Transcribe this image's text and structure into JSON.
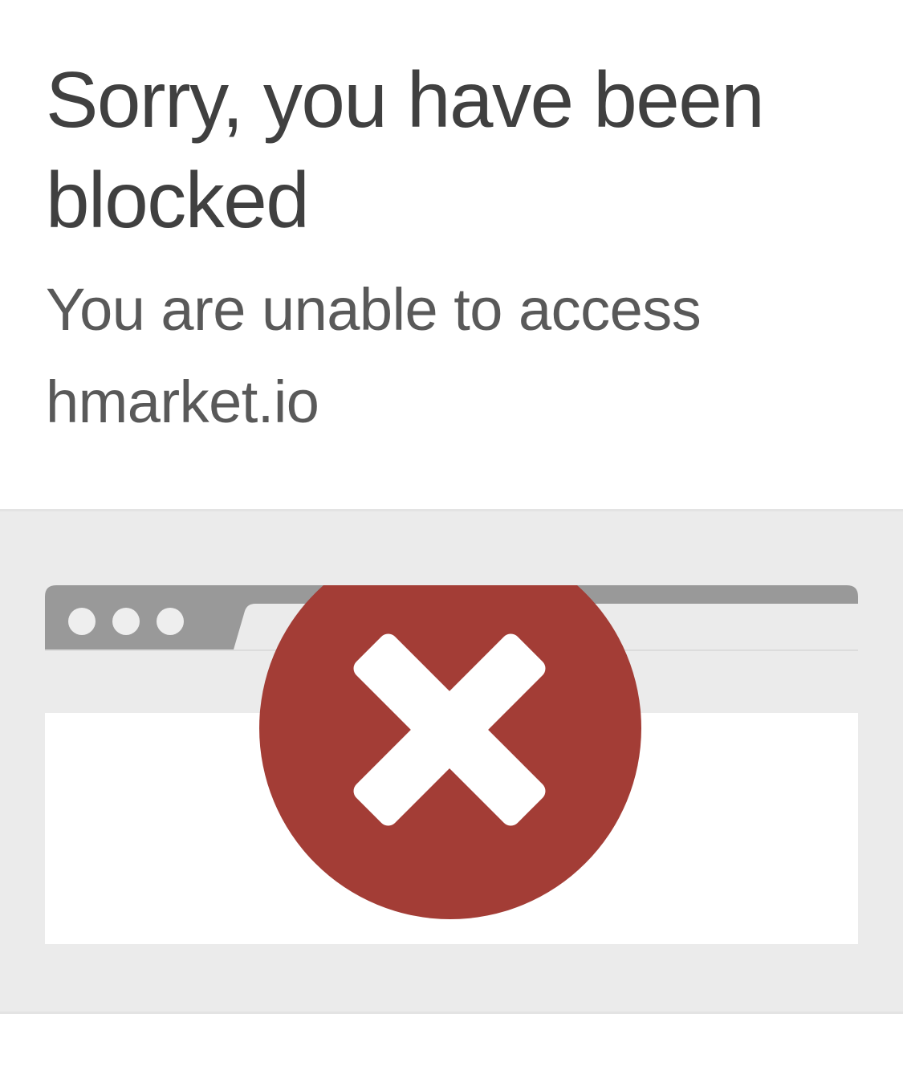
{
  "page": {
    "title": "Sorry, you have been blocked",
    "subtitle_line1": "You are unable to access",
    "subtitle_line2": "hmarket.io"
  },
  "illustration": {
    "icon": "blocked-x-icon",
    "colors": {
      "background": "#ebebeb",
      "browser_bar": "#999999",
      "browser_body": "#ffffff",
      "error_circle": "#a33d36",
      "x_mark": "#ffffff"
    }
  }
}
